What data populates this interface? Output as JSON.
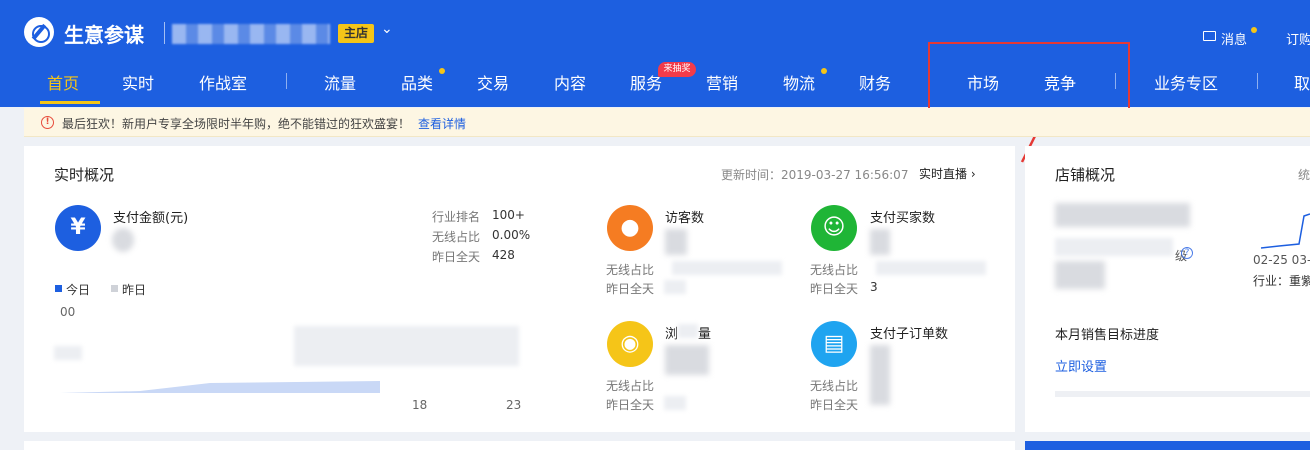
{
  "header": {
    "brand": "生意参谋",
    "shop_badge": "主店",
    "message_label": "消息",
    "order_label": "订购"
  },
  "nav": {
    "items": [
      "首页",
      "实时",
      "作战室",
      "流量",
      "品类",
      "交易",
      "内容",
      "服务",
      "营销",
      "物流",
      "财务",
      "市场",
      "竞争",
      "业务专区",
      "取"
    ],
    "active": "首页",
    "promo_badge": "来抽奖"
  },
  "notice": {
    "text": "最后狂欢！新用户专享全场限时半年购，绝不能错过的狂欢盛宴！",
    "link": "查看详情"
  },
  "realtime": {
    "title": "实时概况",
    "update_time": "更新时间：2019-03-27 16:56:07",
    "live_link": "实时直播",
    "payment": {
      "label": "支付金额(元)",
      "rank_label": "行业排名",
      "rank_value": "100+",
      "wireless_label": "无线占比",
      "wireless_value": "0.00%",
      "yesterday_label": "昨日全天",
      "yesterday_value": "428"
    },
    "visitors": {
      "label": "访客数",
      "wireless_label": "无线占比",
      "yesterday_label": "昨日全天"
    },
    "buyers": {
      "label": "支付买家数",
      "wireless_label": "无线占比",
      "yesterday_label": "昨日全天",
      "yesterday_value": "3"
    },
    "views": {
      "label": "浏",
      "label_tail": "量",
      "wireless_label": "无线占比",
      "yesterday_label": "昨日全天"
    },
    "sub_orders": {
      "label": "支付子订单数",
      "wireless_label": "无线占比",
      "yesterday_label": "昨日全天"
    },
    "legend": {
      "today": "今日",
      "yesterday": "昨日"
    },
    "chart": {
      "y_tick": "00",
      "x_ticks": [
        "18",
        "23"
      ]
    }
  },
  "store": {
    "title": "店铺概况",
    "title_tail": "统",
    "level_suffix": "级",
    "dates": "02-25  03-",
    "industry": "行业：重紫",
    "sales_target": "本月销售目标进度",
    "setup_link": "立即设置"
  },
  "colors": {
    "topbar": "#1d5fe0",
    "accent_yellow": "#f5c518",
    "highlight_red": "#e53935",
    "payment_icon": "#1d5fe0",
    "visitor_icon": "#f57c22",
    "buyer_icon": "#1fb536",
    "view_icon": "#f5c518",
    "order_icon": "#1fa4f0"
  }
}
